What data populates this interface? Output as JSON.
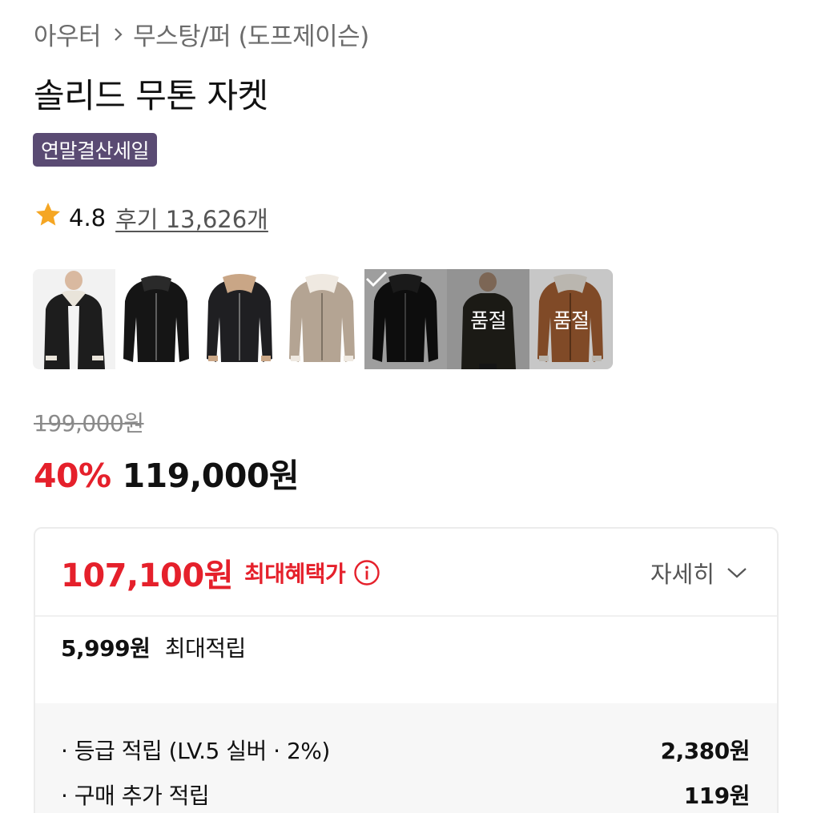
{
  "breadcrumb": {
    "category": "아우터",
    "subcategory": "무스탕/퍼 (도프제이슨)"
  },
  "product": {
    "title": "솔리드 무톤 자켓",
    "badge": "연말결산세일"
  },
  "rating": {
    "score": "4.8",
    "reviews": "후기 13,626개"
  },
  "swatches": [
    {
      "name": "black-shearling-model",
      "selected": false,
      "sold_out": false
    },
    {
      "name": "black-black-fur",
      "selected": false,
      "sold_out": false
    },
    {
      "name": "black-beige-fur",
      "selected": false,
      "sold_out": false
    },
    {
      "name": "beige-cream-fur",
      "selected": false,
      "sold_out": false
    },
    {
      "name": "black-black-fur-alt",
      "selected": true,
      "sold_out": false
    },
    {
      "name": "khaki-model",
      "selected": false,
      "sold_out": true,
      "label": "품절"
    },
    {
      "name": "camel-cream-fur",
      "selected": false,
      "sold_out": true,
      "label": "품절"
    }
  ],
  "price": {
    "original": "199,000원",
    "discount": "40%",
    "sale": "119,000원"
  },
  "benefit": {
    "max_price": "107,100원",
    "max_label": "최대혜택가",
    "detail_label": "자세히",
    "points_total_num": "5,999원",
    "points_total_label": "최대적립",
    "rows": [
      {
        "label": "· 등급 적립 (LV.5 실버 · 2%)",
        "value": "2,380원"
      },
      {
        "label": "· 구매 추가 적립",
        "value": "119원"
      }
    ]
  },
  "colors": {
    "accent_red": "#e5202b",
    "badge_bg": "#5a4b73",
    "star": "#f5a623"
  }
}
